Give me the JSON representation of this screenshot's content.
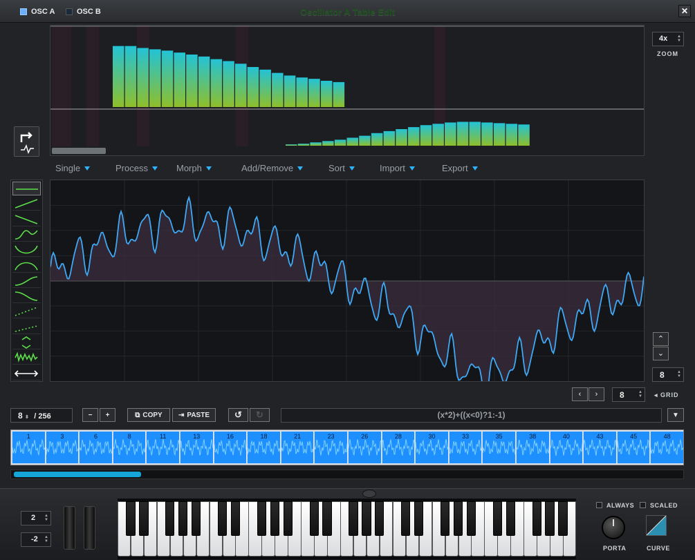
{
  "window": {
    "title": "Oscillator A Table Edit",
    "close": "✕"
  },
  "tabs": [
    {
      "label": "OSC A",
      "checked": true
    },
    {
      "label": "OSC B",
      "checked": false
    }
  ],
  "harmonics": {
    "upper_levels": [
      0.93,
      0.93,
      0.9,
      0.88,
      0.86,
      0.83,
      0.8,
      0.77,
      0.73,
      0.7,
      0.66,
      0.61,
      0.57,
      0.52,
      0.48,
      0.45,
      0.43,
      0.4,
      0.38
    ],
    "lower_levels": [
      0.04,
      0.06,
      0.1,
      0.14,
      0.18,
      0.24,
      0.3,
      0.38,
      0.44,
      0.5,
      0.56,
      0.62,
      0.66,
      0.7,
      0.72,
      0.72,
      0.7,
      0.68,
      0.66,
      0.64
    ]
  },
  "zoom": {
    "value": "4x",
    "label": "ZOOM"
  },
  "menu": [
    "Single",
    "Process",
    "Morph",
    "Add/Remove",
    "Sort",
    "Import",
    "Export"
  ],
  "tools": [
    "flat-line",
    "ramp-up",
    "ramp-down",
    "sine-up",
    "sine-bowl",
    "sine-hump",
    "curve-up",
    "curve-down",
    "dots-up",
    "dots-ramp",
    "expand",
    "noise",
    "stretch"
  ],
  "grid": {
    "value": "8",
    "label": "GRID"
  },
  "vzoom": {
    "value": "8"
  },
  "frame": {
    "current": "8",
    "total": "/ 256"
  },
  "buttons": {
    "minus": "−",
    "plus": "+",
    "copy": "COPY",
    "paste": "PASTE",
    "undo": "↺",
    "redo": "↻",
    "prev": "‹",
    "next": "›",
    "up": "⌃",
    "down": "⌄",
    "dropdown": "▼"
  },
  "formula": "(x*2)+((x<0)?1:-1)",
  "thumbnails": [
    "1",
    "3",
    "6",
    "8",
    "11",
    "13",
    "16",
    "18",
    "21",
    "23",
    "26",
    "28",
    "30",
    "33",
    "35",
    "38",
    "40",
    "43",
    "45",
    "48"
  ],
  "timeline_scroll": 0.19,
  "octave": {
    "upper": "2",
    "lower": "-2"
  },
  "controls": {
    "always": "ALWAYS",
    "scaled": "SCALED",
    "porta": "PORTA",
    "curve": "CURVE"
  },
  "colors": {
    "accent": "#2db3ff",
    "wave": "#3fa9f5",
    "bar_top": "#23c3d6",
    "bar_bottom": "#8fbf2a",
    "thumb": "#1e8fff"
  }
}
